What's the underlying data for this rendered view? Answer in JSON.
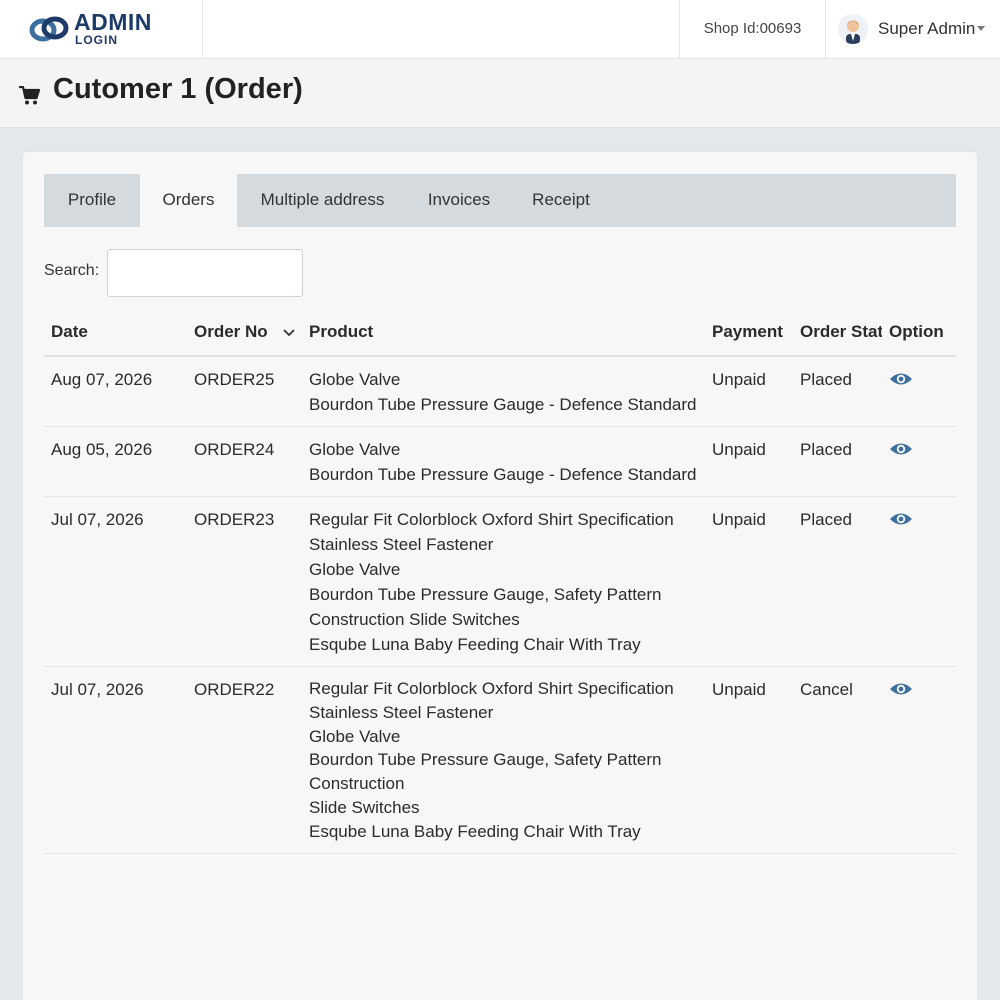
{
  "brand": {
    "title": "ADMIN",
    "subtitle": "LOGIN"
  },
  "header": {
    "shop_id": "Shop Id:00693",
    "user_name": "Super Admin"
  },
  "page": {
    "title": "Cutomer 1 (Order)"
  },
  "tabs": [
    {
      "label": "Profile",
      "active": false
    },
    {
      "label": "Orders",
      "active": true
    },
    {
      "label": "Multiple address",
      "active": false
    },
    {
      "label": "Invoices",
      "active": false
    },
    {
      "label": "Receipt",
      "active": false
    }
  ],
  "search": {
    "label": "Search:",
    "value": ""
  },
  "table": {
    "columns": [
      "Date",
      "Order No",
      "Product",
      "Payment",
      "Order Stat",
      "Option"
    ],
    "rows": [
      {
        "date": "Aug 07, 2026",
        "order_no": "ORDER25",
        "products": [
          "Globe Valve",
          "Bourdon Tube Pressure Gauge - Defence Standard"
        ],
        "payment": "Unpaid",
        "status": "Placed"
      },
      {
        "date": "Aug 05, 2026",
        "order_no": "ORDER24",
        "products": [
          "Globe Valve",
          "Bourdon Tube Pressure Gauge - Defence Standard"
        ],
        "payment": "Unpaid",
        "status": "Placed"
      },
      {
        "date": "Jul 07, 2026",
        "order_no": "ORDER23",
        "products": [
          "Regular Fit Colorblock Oxford Shirt Specification",
          "Stainless Steel Fastener",
          "Globe Valve",
          "Bourdon Tube Pressure Gauge, Safety Pattern",
          "Construction Slide Switches",
          "Esqube Luna Baby Feeding Chair With Tray"
        ],
        "payment": "Unpaid",
        "status": "Placed"
      },
      {
        "date": "Jul 07, 2026",
        "order_no": "ORDER22",
        "products": [
          "Regular Fit Colorblock Oxford Shirt Specification",
          "Stainless Steel Fastener",
          "Globe Valve",
          "Bourdon Tube Pressure Gauge, Safety Pattern",
          "Construction",
          "Slide Switches",
          "Esqube Luna Baby Feeding Chair With Tray"
        ],
        "payment": "Unpaid",
        "status": "Cancel"
      }
    ]
  },
  "colors": {
    "brand": "#1e3a68",
    "accent": "#3d6f9e",
    "tab_bar": "#d5dade"
  },
  "icons": {
    "cart": "cart-icon",
    "view": "eye-icon",
    "sort": "chevron-down-icon"
  }
}
